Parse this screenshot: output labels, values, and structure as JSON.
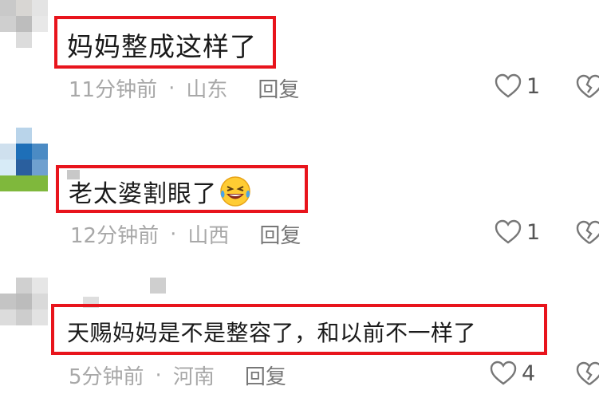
{
  "comments": [
    {
      "text": "妈妈整成这样了",
      "time": "11分钟前",
      "location": "山东",
      "reply_label": "回复",
      "likes": "1"
    },
    {
      "text": "老太婆割眼了",
      "emoji": "laughing-crying-emoji",
      "time": "12分钟前",
      "location": "山西",
      "reply_label": "回复",
      "likes": "1"
    },
    {
      "text": "天赐妈妈是不是整容了，和以前不一样了",
      "time": "5分钟前",
      "location": "河南",
      "reply_label": "回复",
      "likes": "4"
    }
  ],
  "separator": "·",
  "colors": {
    "highlight_box": "#e8141c",
    "meta_text": "#a8a8a8",
    "reply_text": "#777777",
    "comment_text": "#1a1a1a"
  },
  "icons": [
    "heart-outline-icon",
    "broken-heart-icon",
    "laughing-crying-emoji"
  ]
}
